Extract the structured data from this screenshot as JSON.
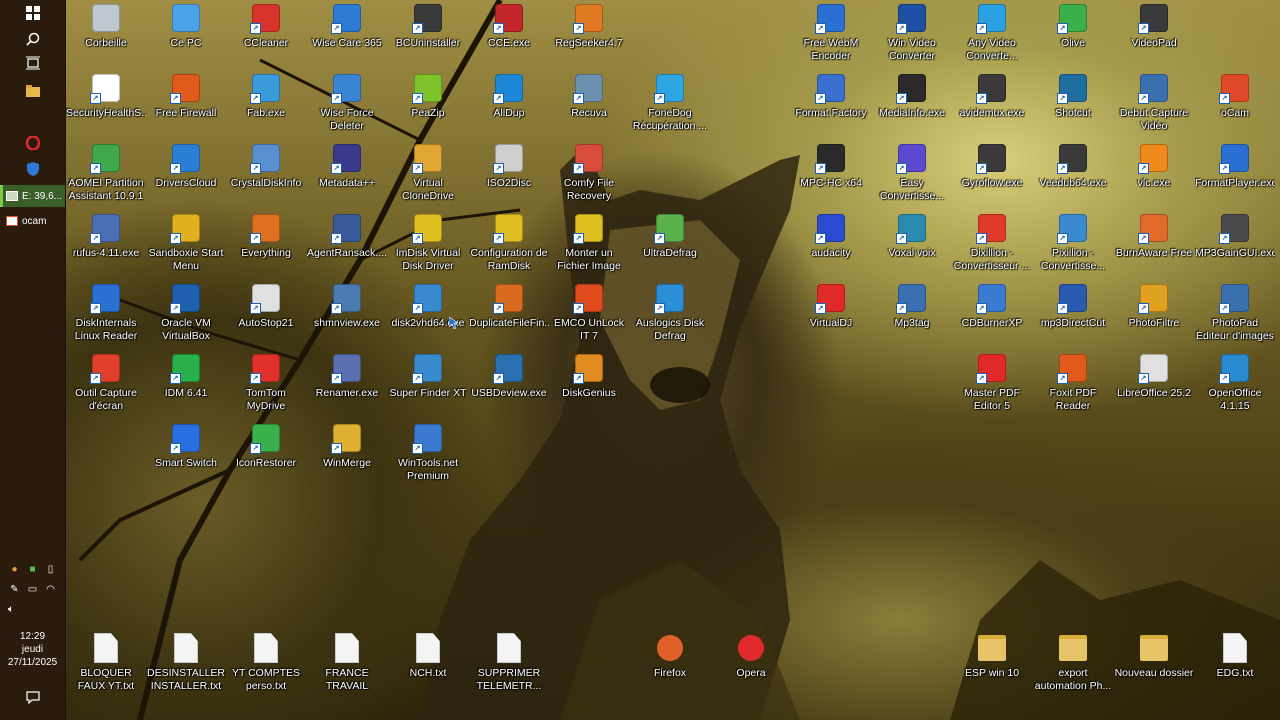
{
  "taskbar": {
    "start_icon": "windows-icon",
    "search_icon": "search-icon",
    "taskview_icon": "task-view-icon",
    "pinned": [
      {
        "name": "explorer-icon",
        "color": "#e8b84a"
      },
      {
        "name": "opera-icon",
        "color": "#e0252b"
      },
      {
        "name": "security-shield-icon",
        "color": "#2f79d6"
      }
    ],
    "windows": [
      {
        "label": "E: 39,6...",
        "active": true
      },
      {
        "label": "ocam",
        "active": false
      }
    ],
    "tray_row1": [
      "network-icon",
      "defender-icon",
      "usb-icon"
    ],
    "tray_row2": [
      "pen-icon",
      "battery-icon",
      "wifi-icon"
    ],
    "volume_icon": "volume-icon",
    "clock": {
      "time": "12:29",
      "day": "jeudi",
      "date": "27/11/2025"
    },
    "notification_icon": "notification-icon"
  },
  "desktop": {
    "icons": [
      {
        "label": "Corbeille",
        "color": "#bfc7d0",
        "shortcut": false
      },
      {
        "label": "Ce PC",
        "color": "#4aa3e8",
        "shortcut": false
      },
      {
        "label": "CCleaner",
        "color": "#d9342b",
        "shortcut": true
      },
      {
        "label": "Wise Care 365",
        "color": "#2e7bd6",
        "shortcut": true
      },
      {
        "label": "BCUninstaller",
        "color": "#3a3a3a",
        "shortcut": true
      },
      {
        "label": "CCE.exe",
        "color": "#c4262e",
        "shortcut": true
      },
      {
        "label": "RegSeeker4.7",
        "color": "#e07a22",
        "shortcut": true
      },
      {
        "label": "SecurityHealthS...",
        "color": "#ffffff",
        "shortcut": true
      },
      {
        "label": "Free Firewall",
        "color": "#e05a1c",
        "shortcut": true
      },
      {
        "label": "Fab.exe",
        "color": "#3b9ad9",
        "shortcut": true
      },
      {
        "label": "Wise Force Deleter",
        "color": "#3a84d4",
        "shortcut": true
      },
      {
        "label": "PeaZip",
        "color": "#7ec42a",
        "shortcut": true
      },
      {
        "label": "AllDup",
        "color": "#1e88d8",
        "shortcut": true
      },
      {
        "label": "Recuva",
        "color": "#6b8fae",
        "shortcut": true
      },
      {
        "label": "FoneDog Récupération ...",
        "color": "#2ba6e0",
        "shortcut": true
      },
      {
        "label": "AOMEI Partition Assistant 10.9.1",
        "color": "#3fa84a",
        "shortcut": true
      },
      {
        "label": "DriversCloud",
        "color": "#2a7fd4",
        "shortcut": true
      },
      {
        "label": "CrystalDiskInfo",
        "color": "#5a8fd0",
        "shortcut": true
      },
      {
        "label": "Metadata++",
        "color": "#3a3a8c",
        "shortcut": true
      },
      {
        "label": "Virtual CloneDrive",
        "color": "#e0a630",
        "shortcut": true
      },
      {
        "label": "ISO2Disc",
        "color": "#cfcfcf",
        "shortcut": true
      },
      {
        "label": "Comfy File Recovery",
        "color": "#d94b3a",
        "shortcut": true
      },
      {
        "label": "rufus-4.11.exe",
        "color": "#4a6fb5",
        "shortcut": true
      },
      {
        "label": "Sandboxie Start Menu",
        "color": "#e0b020",
        "shortcut": true
      },
      {
        "label": "Everything",
        "color": "#e07020",
        "shortcut": true
      },
      {
        "label": "AgentRansack....",
        "color": "#3a5a9a",
        "shortcut": true
      },
      {
        "label": "ImDisk Virtual Disk Driver",
        "color": "#e0c020",
        "shortcut": true
      },
      {
        "label": "Configuration de RamDisk",
        "color": "#e0c020",
        "shortcut": true
      },
      {
        "label": "Monter un Fichier Image",
        "color": "#e0c020",
        "shortcut": true
      },
      {
        "label": "UltraDefrag",
        "color": "#5ab04a",
        "shortcut": true
      },
      {
        "label": "DiskInternals Linux Reader",
        "color": "#2a6fd4",
        "shortcut": true
      },
      {
        "label": "Oracle VM VirtualBox",
        "color": "#1e5fb0",
        "shortcut": true
      },
      {
        "label": "AutoStop21",
        "color": "#e0e0e0",
        "shortcut": true
      },
      {
        "label": "shmnview.exe",
        "color": "#4a7ab0",
        "shortcut": true
      },
      {
        "label": "disk2vhd64.exe",
        "color": "#3a8ad0",
        "shortcut": true
      },
      {
        "label": "DuplicateFileFin...",
        "color": "#d96a20",
        "shortcut": true
      },
      {
        "label": "EMCO UnLock IT 7",
        "color": "#e04a1c",
        "shortcut": true
      },
      {
        "label": "Auslogics Disk Defrag",
        "color": "#2a8fd4",
        "shortcut": true
      },
      {
        "label": "Outil Capture d'écran",
        "color": "#e0402a",
        "shortcut": true
      },
      {
        "label": "IDM 6.41",
        "color": "#2ab04a",
        "shortcut": true
      },
      {
        "label": "TomTom MyDrive Connect",
        "color": "#e0302a",
        "shortcut": true
      },
      {
        "label": "Renamer.exe",
        "color": "#5a6fb0",
        "shortcut": true
      },
      {
        "label": "Super Finder XT",
        "color": "#3a8ad0",
        "shortcut": true
      },
      {
        "label": "USBDeview.exe",
        "color": "#2a6fb0",
        "shortcut": true
      },
      {
        "label": "DiskGenius",
        "color": "#e08a20",
        "shortcut": true
      },
      {
        "label": "Smart Switch",
        "color": "#2a6fe0",
        "shortcut": true
      },
      {
        "label": "IconRestorer",
        "color": "#3ab04a",
        "shortcut": true
      },
      {
        "label": "WinMerge",
        "color": "#e0b030",
        "shortcut": true
      },
      {
        "label": "WinTools.net Premium",
        "color": "#3a7ad0",
        "shortcut": true
      },
      {
        "label": "Free WebM Encoder",
        "color": "#2a6fd4",
        "shortcut": true
      },
      {
        "label": "Win Video Converter",
        "color": "#1e4fa0",
        "shortcut": true
      },
      {
        "label": "Any Video Converte...",
        "color": "#2aa0e0",
        "shortcut": true
      },
      {
        "label": "Olive",
        "color": "#3ab04a",
        "shortcut": true
      },
      {
        "label": "VideoPad",
        "color": "#3a3a3a",
        "shortcut": true
      },
      {
        "label": "Format Factory",
        "color": "#3a6fd0",
        "shortcut": true
      },
      {
        "label": "MediaInfo.exe",
        "color": "#2a2a2a",
        "shortcut": true
      },
      {
        "label": "avidemux.exe",
        "color": "#3a3a3a",
        "shortcut": true
      },
      {
        "label": "Shotcut",
        "color": "#1e6fa0",
        "shortcut": true
      },
      {
        "label": "Debut Capture Vidéo",
        "color": "#3a6fb0",
        "shortcut": true
      },
      {
        "label": "oCam",
        "color": "#e04a2a",
        "shortcut": true
      },
      {
        "label": "MPC-HC x64",
        "color": "#2a2a2a",
        "shortcut": true
      },
      {
        "label": "Easy Convertisse...",
        "color": "#5a4ad0",
        "shortcut": true
      },
      {
        "label": "Gyroflow.exe",
        "color": "#3a3a3a",
        "shortcut": true
      },
      {
        "label": "Veedub64.exe",
        "color": "#3a3a3a",
        "shortcut": true
      },
      {
        "label": "vlc.exe",
        "color": "#f08a1c",
        "shortcut": true
      },
      {
        "label": "FormatPlayer.exe",
        "color": "#2a6fd4",
        "shortcut": true
      },
      {
        "label": "audacity",
        "color": "#2a4ad0",
        "shortcut": true
      },
      {
        "label": "Voxal voix",
        "color": "#2a8ab0",
        "shortcut": true
      },
      {
        "label": "Dixillion - Convertisseur ...",
        "color": "#e03a2a",
        "shortcut": true
      },
      {
        "label": "Pixillion - Convertisse...",
        "color": "#3a8ad0",
        "shortcut": true
      },
      {
        "label": "BurnAware Free",
        "color": "#e06a2a",
        "shortcut": true
      },
      {
        "label": "MP3GainGUI.exe",
        "color": "#4a4a4a",
        "shortcut": true
      },
      {
        "label": "VirtualDJ",
        "color": "#e02a2a",
        "shortcut": true
      },
      {
        "label": "Mp3tag",
        "color": "#3a6fb0",
        "shortcut": true
      },
      {
        "label": "CDBurnerXP",
        "color": "#3a7ad0",
        "shortcut": true
      },
      {
        "label": "mp3DirectCut",
        "color": "#2a5ab0",
        "shortcut": true
      },
      {
        "label": "PhotoFiltre",
        "color": "#e0a020",
        "shortcut": true
      },
      {
        "label": "PhotoPad Éditeur d'images",
        "color": "#3a6fb0",
        "shortcut": true
      },
      {
        "label": "Master PDF Editor 5",
        "color": "#e02a2a",
        "shortcut": true
      },
      {
        "label": "Foxit PDF Reader",
        "color": "#e05a1c",
        "shortcut": true
      },
      {
        "label": "LibreOffice 25.2",
        "color": "#e0e0e0",
        "shortcut": true
      },
      {
        "label": "OpenOffice 4.1.15",
        "color": "#2a8ad0",
        "shortcut": true
      }
    ],
    "bottom_files": [
      {
        "label": "BLOQUER FAUX YT.txt",
        "kind": "file"
      },
      {
        "label": "DESINSTALLER INSTALLER.txt",
        "kind": "file"
      },
      {
        "label": "YT COMPTES perso.txt",
        "kind": "file"
      },
      {
        "label": "FRANCE TRAVAIL contact.txt",
        "kind": "file"
      },
      {
        "label": "NCH.txt",
        "kind": "file"
      },
      {
        "label": "SUPPRIMER TELEMETR...",
        "kind": "file"
      },
      {
        "label": "Firefox",
        "kind": "app",
        "color": "#e0602a"
      },
      {
        "label": "Opera",
        "kind": "app",
        "color": "#e02a2a"
      },
      {
        "label": "ESP win 10",
        "kind": "folder"
      },
      {
        "label": "export automation Ph...",
        "kind": "folder"
      },
      {
        "label": "Nouveau dossier",
        "kind": "folder"
      },
      {
        "label": "EDG.txt",
        "kind": "file"
      }
    ]
  }
}
